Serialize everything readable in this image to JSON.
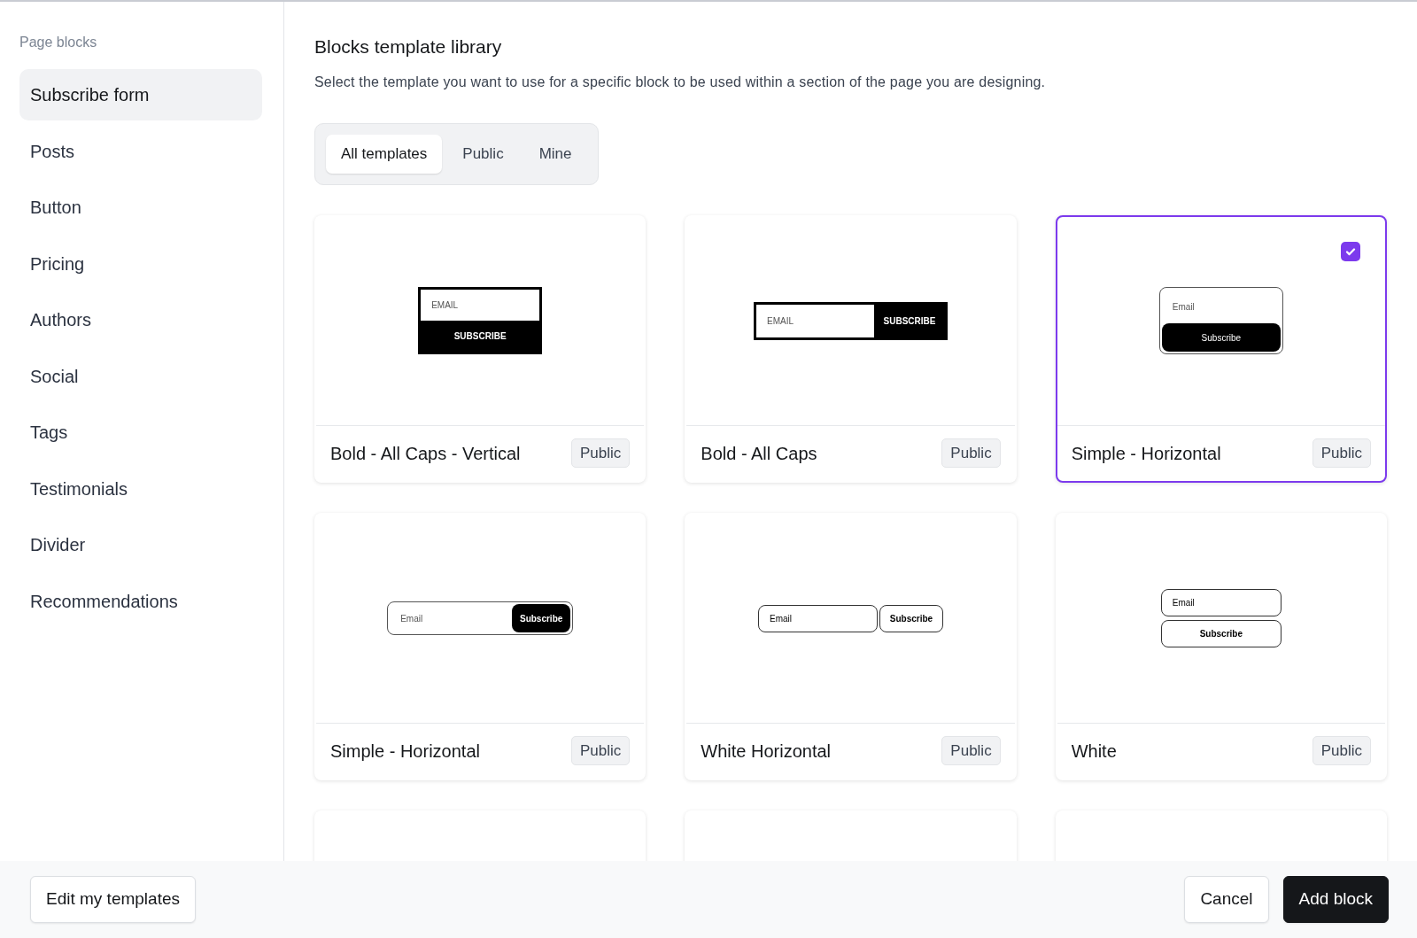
{
  "sidebar": {
    "heading": "Page blocks",
    "items": [
      {
        "label": "Subscribe form",
        "selected": true
      },
      {
        "label": "Posts",
        "selected": false
      },
      {
        "label": "Button",
        "selected": false
      },
      {
        "label": "Pricing",
        "selected": false
      },
      {
        "label": "Authors",
        "selected": false
      },
      {
        "label": "Social",
        "selected": false
      },
      {
        "label": "Tags",
        "selected": false
      },
      {
        "label": "Testimonials",
        "selected": false
      },
      {
        "label": "Divider",
        "selected": false
      },
      {
        "label": "Recommendations",
        "selected": false
      }
    ]
  },
  "main": {
    "title": "Blocks template library",
    "description": "Select the template you want to use for a specific block to be used within a section of the page you are designing.",
    "tabs": [
      {
        "label": "All templates",
        "selected": true
      },
      {
        "label": "Public",
        "selected": false
      },
      {
        "label": "Mine",
        "selected": false
      }
    ],
    "templates": [
      {
        "kind": "caps-vertical",
        "name": "Bold - All Caps - Vertical",
        "badge": "Public",
        "selected": false,
        "preview": {
          "placeholder": "EMAIL",
          "button": "SUBSCRIBE"
        }
      },
      {
        "kind": "caps-inline",
        "name": "Bold - All Caps",
        "badge": "Public",
        "selected": false,
        "preview": {
          "placeholder": "EMAIL",
          "button": "SUBSCRIBE"
        }
      },
      {
        "kind": "rounded-vertical",
        "name": "Simple - Horizontal",
        "badge": "Public",
        "selected": true,
        "preview": {
          "placeholder": "Email",
          "button": "Subscribe"
        }
      },
      {
        "kind": "rounded-inline",
        "name": "Simple - Horizontal",
        "badge": "Public",
        "selected": false,
        "preview": {
          "placeholder": "Email",
          "button": "Subscribe"
        }
      },
      {
        "kind": "outline-inline",
        "name": "White Horizontal",
        "badge": "Public",
        "selected": false,
        "preview": {
          "placeholder": "Email",
          "button": "Subscribe"
        }
      },
      {
        "kind": "outline-vertical",
        "name": "White",
        "badge": "Public",
        "selected": false,
        "preview": {
          "placeholder": "Email",
          "button": "Subscribe"
        }
      },
      {
        "kind": "cut-off"
      },
      {
        "kind": "cut-off"
      },
      {
        "kind": "cut-off"
      }
    ]
  },
  "footer": {
    "left_button": "Edit my templates",
    "buttons": [
      {
        "label": "Cancel",
        "kind": "secondary"
      },
      {
        "label": "Add block",
        "kind": "primary"
      }
    ]
  }
}
